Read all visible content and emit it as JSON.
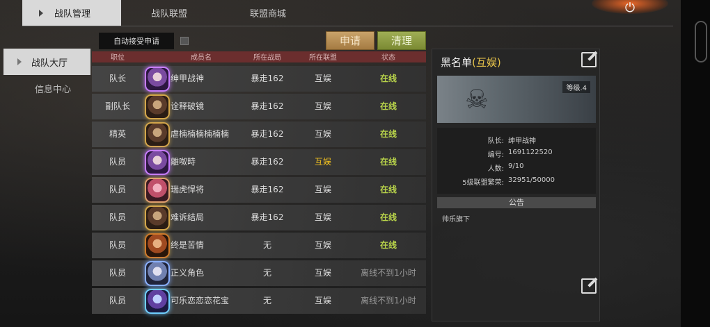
{
  "tabs": [
    {
      "label": "战队管理",
      "active": true
    },
    {
      "label": "战队联盟",
      "active": false
    },
    {
      "label": "联盟商城",
      "active": false
    }
  ],
  "sidebar": {
    "items": [
      {
        "label": "战队大厅",
        "active": true
      },
      {
        "label": "信息中心",
        "active": false
      }
    ]
  },
  "controls": {
    "auto_accept_label": "自动接受申请",
    "apply_label": "申请",
    "clear_label": "清理"
  },
  "table": {
    "headers": [
      "职位",
      "成员名",
      "所在战局",
      "所在联盟",
      "状态"
    ],
    "rows": [
      {
        "position": "队长",
        "name": "绅甲战神",
        "zone": "暴走162",
        "alliance": "互娱",
        "status": "在线",
        "online": true
      },
      {
        "position": "副队长",
        "name": "诠释破镜",
        "zone": "暴走162",
        "alliance": "互娱",
        "status": "在线",
        "online": true
      },
      {
        "position": "精英",
        "name": "虐楠楠楠楠楠楠",
        "zone": "暴走162",
        "alliance": "互娱",
        "status": "在线",
        "online": true
      },
      {
        "position": "队员",
        "name": "離呶時",
        "zone": "暴走162",
        "alliance": "互娱",
        "status": "在线",
        "online": true
      },
      {
        "position": "队员",
        "name": "瑞虎悍将",
        "zone": "暴走162",
        "alliance": "互娱",
        "status": "在线",
        "online": true
      },
      {
        "position": "队员",
        "name": "难诉结局",
        "zone": "暴走162",
        "alliance": "互娱",
        "status": "在线",
        "online": true
      },
      {
        "position": "队员",
        "name": "终是苦情",
        "zone": "无",
        "alliance": "互娱",
        "status": "在线",
        "online": true
      },
      {
        "position": "队员",
        "name": "正义角色",
        "zone": "无",
        "alliance": "互娱",
        "status": "离线不到1小时",
        "online": false
      },
      {
        "position": "队员",
        "name": "可乐恋恋恋花宝",
        "zone": "无",
        "alliance": "互娱",
        "status": "离线不到1小时",
        "online": false
      }
    ]
  },
  "panel": {
    "title": "黑名单",
    "title_suffix": "(互娱)",
    "level": "等级.4",
    "info": [
      {
        "key": "队长:",
        "value": "绅甲战神"
      },
      {
        "key": "编号:",
        "value": "1691122520"
      },
      {
        "key": "人数:",
        "value": "9/10"
      },
      {
        "key": "5级联盟繁荣:",
        "value": "32951/50000"
      }
    ],
    "notice_header": "公告",
    "notice_text": "帅乐旗下"
  },
  "colors": {
    "online": "#b8d34a",
    "offline": "#9a9a9a",
    "header_bg": "#6b2e2e",
    "apply_btn": "#c9a36a",
    "clear_btn": "#9fae55",
    "panel_gold": "#e6c34a"
  }
}
